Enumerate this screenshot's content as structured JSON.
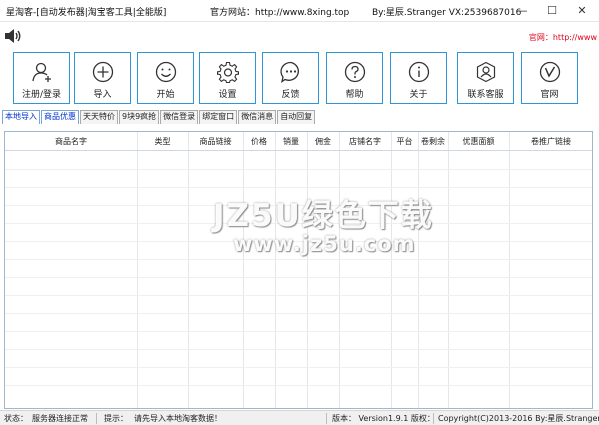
{
  "window": {
    "title": "星淘客-[自动发布器|淘宝客工具|全能版]",
    "site": "官方网站：http://www.8xing.top",
    "author": "By:星辰.Stranger   VX:2539687016",
    "minimize": "—",
    "maximize": "☐",
    "close": "✕"
  },
  "top": {
    "official_link": "官网：http://www"
  },
  "toolbar": {
    "items": [
      {
        "label": "注册/登录",
        "icon": "user-add-icon"
      },
      {
        "label": "导入",
        "icon": "plus-circle-icon"
      },
      {
        "label": "开始",
        "icon": "smile-icon"
      },
      {
        "label": "设置",
        "icon": "gear-icon"
      },
      {
        "label": "反馈",
        "icon": "chat-icon"
      },
      {
        "label": "帮助",
        "icon": "question-icon"
      },
      {
        "label": "关于",
        "icon": "info-icon"
      },
      {
        "label": "联系客服",
        "icon": "support-icon"
      },
      {
        "label": "官网",
        "icon": "v-icon"
      }
    ],
    "accent": "#2f96d6"
  },
  "tabs": [
    {
      "label": "本地导入",
      "active": true
    },
    {
      "label": "商品优惠",
      "active": true
    },
    {
      "label": "天天特价",
      "active": false
    },
    {
      "label": "9块9疯抢",
      "active": false
    },
    {
      "label": "微信登录",
      "active": false
    },
    {
      "label": "绑定窗口",
      "active": false
    },
    {
      "label": "微信消息",
      "active": false
    },
    {
      "label": "自动回复",
      "active": false
    }
  ],
  "grid": {
    "columns": [
      "商品名字",
      "类型",
      "商品链接",
      "价格",
      "销量",
      "佣金",
      "店铺名字",
      "平台",
      "卷剩余",
      "优惠面额",
      "卷推广链接"
    ]
  },
  "watermark": {
    "line1": "JZ5U绿色下载",
    "line2": "www.jz5u.com"
  },
  "status": {
    "state_label": "状态：",
    "state_value": "服务器连接正常",
    "tip_label": "提示：",
    "tip_value": "请先导入本地淘客数据！",
    "version": "版本： Version1.9.1 版权：",
    "copyright": "Copyright(C)2013-2016 By:星辰.Stranger"
  }
}
